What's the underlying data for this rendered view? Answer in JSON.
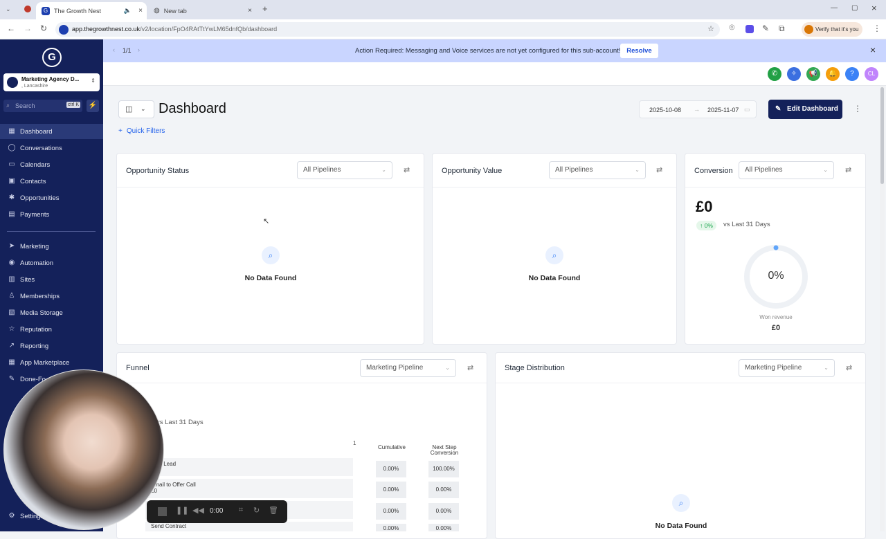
{
  "browser": {
    "tabs": [
      {
        "title": "The Growth Nest"
      },
      {
        "title": "New tab"
      }
    ],
    "url_host": "app.thegrowthnest.co.uk",
    "url_path": "/v2/location/FpO4RAtTtYwLM65dnfQb/dashboard",
    "profile_label": "Verify that it's you"
  },
  "sidebar": {
    "account_name": "Marketing Agency D...",
    "account_sub": ", Lancashire",
    "search_placeholder": "Search",
    "search_shortcut": "ctrl K",
    "items": [
      {
        "label": "Dashboard",
        "icon": "grid-icon"
      },
      {
        "label": "Conversations",
        "icon": "chat-icon"
      },
      {
        "label": "Calendars",
        "icon": "calendar-icon"
      },
      {
        "label": "Contacts",
        "icon": "contacts-icon"
      },
      {
        "label": "Opportunities",
        "icon": "opportunities-icon"
      },
      {
        "label": "Payments",
        "icon": "payments-icon"
      },
      {
        "label": "Marketing",
        "icon": "send-icon"
      },
      {
        "label": "Automation",
        "icon": "automation-icon"
      },
      {
        "label": "Sites",
        "icon": "sites-icon"
      },
      {
        "label": "Memberships",
        "icon": "memberships-icon"
      },
      {
        "label": "Media Storage",
        "icon": "media-icon"
      },
      {
        "label": "Reputation",
        "icon": "star-icon"
      },
      {
        "label": "Reporting",
        "icon": "chart-icon"
      },
      {
        "label": "App Marketplace",
        "icon": "apps-icon"
      },
      {
        "label": "Done-Fo",
        "icon": "wrench-icon"
      }
    ],
    "settings_label": "Settings"
  },
  "banner": {
    "pager": "1/1",
    "message": "Action Required: Messaging and Voice services are not yet configured for this sub-account!",
    "resolve_label": "Resolve"
  },
  "header": {
    "title": "Dashboard",
    "date_start": "2025-10-08",
    "date_end": "2025-11-07",
    "edit_label": "Edit Dashboard",
    "quick_filters_label": "Quick Filters"
  },
  "cards": {
    "opp_status": {
      "title": "Opportunity Status",
      "select": "All Pipelines",
      "empty": "No Data Found"
    },
    "opp_value": {
      "title": "Opportunity Value",
      "select": "All Pipelines",
      "empty": "No Data Found"
    },
    "conversion": {
      "title": "Conversion",
      "select": "All Pipelines",
      "amount": "£0",
      "delta": "0%",
      "compare": "vs Last 31 Days",
      "gauge": "0%",
      "gauge_value": 0,
      "won_label": "Won revenue",
      "won_value": "£0"
    },
    "funnel": {
      "title": "Funnel",
      "select": "Marketing Pipeline",
      "compare": "vs Last 31 Days",
      "col_one": "1",
      "col_cumulative": "Cumulative",
      "col_next": "Next Step Conversion",
      "rows": [
        {
          "stage": "New Lead",
          "extra": "",
          "cumulative": "0.00%",
          "next": "100.00%"
        },
        {
          "stage": "Email to Offer Call",
          "extra": "£0",
          "cumulative": "0.00%",
          "next": "0.00%"
        },
        {
          "stage": "",
          "extra": "",
          "cumulative": "0.00%",
          "next": "0.00%"
        },
        {
          "stage": "Send Contract",
          "extra": "",
          "cumulative": "0.00%",
          "next": "0.00%"
        }
      ]
    },
    "stage_dist": {
      "title": "Stage Distribution",
      "select": "Marketing Pipeline",
      "empty": "No Data Found"
    }
  },
  "recorder": {
    "time": "0:00"
  }
}
